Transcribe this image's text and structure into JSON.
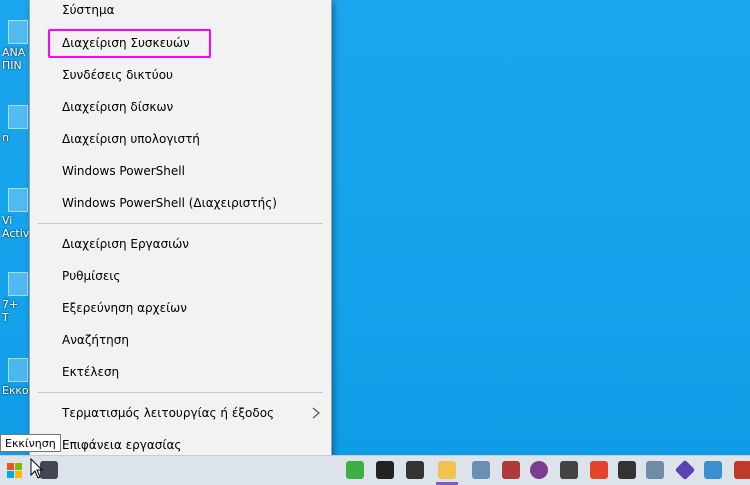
{
  "desktop_icons": [
    {
      "label": "ΑΝΑ",
      "label2": "ΠΙΝ"
    },
    {
      "label": "n",
      "label2": ""
    },
    {
      "label": "Vi",
      "label2": "Activ"
    },
    {
      "label": "7+",
      "label2": "T"
    },
    {
      "label": "Εκκο",
      "label2": ""
    }
  ],
  "menu": {
    "items": [
      {
        "label": "Σύστημα"
      },
      {
        "label": "Διαχείριση Συσκευών"
      },
      {
        "label": "Συνδέσεις δικτύου"
      },
      {
        "label": "Διαχείριση δίσκων"
      },
      {
        "label": "Διαχείριση υπολογιστή"
      },
      {
        "label": "Windows PowerShell"
      },
      {
        "label": "Windows PowerShell (Διαχειριστής)"
      },
      {
        "label": "Διαχείριση Εργασιών"
      },
      {
        "label": "Ρυθμίσεις"
      },
      {
        "label": "Εξερεύνηση αρχείων"
      },
      {
        "label": "Αναζήτηση"
      },
      {
        "label": "Εκτέλεση"
      },
      {
        "label": "Τερματισμός λειτουργίας ή έξοδος"
      },
      {
        "label": "Επιφάνεια εργασίας"
      }
    ]
  },
  "tooltip": "Εκκίνηση",
  "colors": {
    "highlight": "#ff00ff",
    "desktop": "#14a3ec",
    "taskbar": "#dde3ea"
  }
}
